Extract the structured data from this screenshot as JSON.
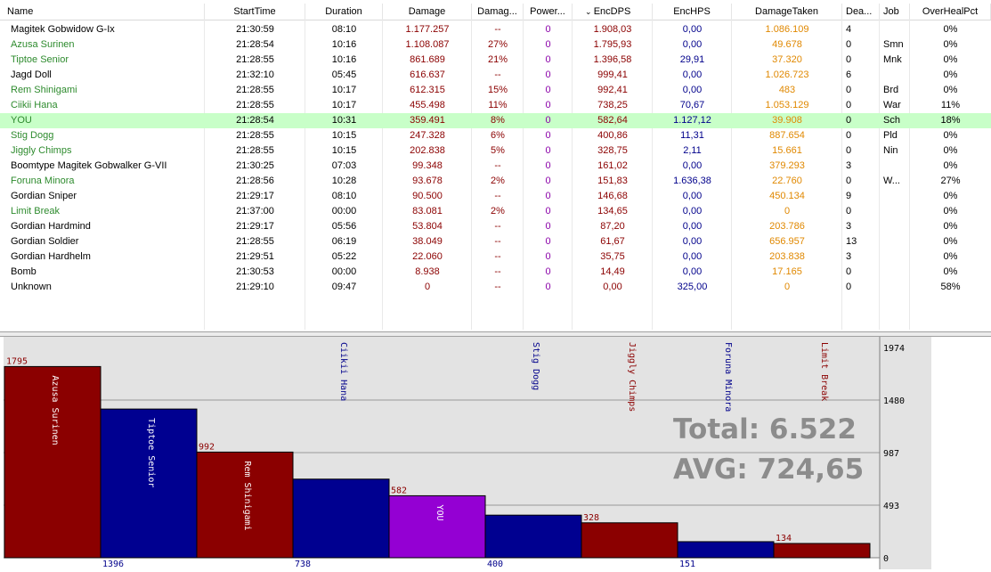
{
  "columns": [
    {
      "key": "name",
      "label": "Name",
      "align": "left"
    },
    {
      "key": "start",
      "label": "StartTime",
      "align": "center"
    },
    {
      "key": "duration",
      "label": "Duration",
      "align": "center"
    },
    {
      "key": "damage",
      "label": "Damage",
      "align": "center"
    },
    {
      "key": "damage_pct",
      "label": "Damag...",
      "align": "center"
    },
    {
      "key": "power",
      "label": "Power...",
      "align": "center"
    },
    {
      "key": "encdps",
      "label": "EncDPS",
      "align": "center"
    },
    {
      "key": "enchps",
      "label": "EncHPS",
      "align": "center"
    },
    {
      "key": "taken",
      "label": "DamageTaken",
      "align": "center"
    },
    {
      "key": "deaths",
      "label": "Dea...",
      "align": "left"
    },
    {
      "key": "job",
      "label": "Job",
      "align": "left"
    },
    {
      "key": "overheal",
      "label": "OverHealPct",
      "align": "center"
    }
  ],
  "sort_indicator": "⌄",
  "colors": {
    "ally": "#2e8b2e",
    "enemy": "#000000",
    "damage": "#8b0000",
    "power": "#8a00a8",
    "dps": "#8b0000",
    "hps": "#00008b",
    "taken": "#e08800",
    "selected": "#c8ffc8",
    "bar_red": "#8b0000",
    "bar_blue": "#000090",
    "bar_you": "#9400d3",
    "total_text": "#8c8c8c"
  },
  "rows": [
    {
      "name": "Magitek Gobwidow G-Ix",
      "start": "21:30:59",
      "duration": "08:10",
      "damage": "1.177.257",
      "damage_pct": "--",
      "power": "0",
      "encdps": "1.908,03",
      "enchps": "0,00",
      "taken": "1.086.109",
      "deaths": "4",
      "job": "",
      "overheal": "0%",
      "kind": "enemy",
      "selected": false
    },
    {
      "name": "Azusa Surinen",
      "start": "21:28:54",
      "duration": "10:16",
      "damage": "1.108.087",
      "damage_pct": "27%",
      "power": "0",
      "encdps": "1.795,93",
      "enchps": "0,00",
      "taken": "49.678",
      "deaths": "0",
      "job": "Smn",
      "overheal": "0%",
      "kind": "ally",
      "selected": false
    },
    {
      "name": "Tiptoe Senior",
      "start": "21:28:55",
      "duration": "10:16",
      "damage": "861.689",
      "damage_pct": "21%",
      "power": "0",
      "encdps": "1.396,58",
      "enchps": "29,91",
      "taken": "37.320",
      "deaths": "0",
      "job": "Mnk",
      "overheal": "0%",
      "kind": "ally",
      "selected": false
    },
    {
      "name": "Jagd Doll",
      "start": "21:32:10",
      "duration": "05:45",
      "damage": "616.637",
      "damage_pct": "--",
      "power": "0",
      "encdps": "999,41",
      "enchps": "0,00",
      "taken": "1.026.723",
      "deaths": "6",
      "job": "",
      "overheal": "0%",
      "kind": "enemy",
      "selected": false
    },
    {
      "name": "Rem Shinigami",
      "start": "21:28:55",
      "duration": "10:17",
      "damage": "612.315",
      "damage_pct": "15%",
      "power": "0",
      "encdps": "992,41",
      "enchps": "0,00",
      "taken": "483",
      "deaths": "0",
      "job": "Brd",
      "overheal": "0%",
      "kind": "ally",
      "selected": false
    },
    {
      "name": "Ciikii Hana",
      "start": "21:28:55",
      "duration": "10:17",
      "damage": "455.498",
      "damage_pct": "11%",
      "power": "0",
      "encdps": "738,25",
      "enchps": "70,67",
      "taken": "1.053.129",
      "deaths": "0",
      "job": "War",
      "overheal": "11%",
      "kind": "ally",
      "selected": false
    },
    {
      "name": "YOU",
      "start": "21:28:54",
      "duration": "10:31",
      "damage": "359.491",
      "damage_pct": "8%",
      "power": "0",
      "encdps": "582,64",
      "enchps": "1.127,12",
      "taken": "39.908",
      "deaths": "0",
      "job": "Sch",
      "overheal": "18%",
      "kind": "ally",
      "selected": true
    },
    {
      "name": "Stig Dogg",
      "start": "21:28:55",
      "duration": "10:15",
      "damage": "247.328",
      "damage_pct": "6%",
      "power": "0",
      "encdps": "400,86",
      "enchps": "11,31",
      "taken": "887.654",
      "deaths": "0",
      "job": "Pld",
      "overheal": "0%",
      "kind": "ally",
      "selected": false
    },
    {
      "name": "Jiggly Chimps",
      "start": "21:28:55",
      "duration": "10:15",
      "damage": "202.838",
      "damage_pct": "5%",
      "power": "0",
      "encdps": "328,75",
      "enchps": "2,11",
      "taken": "15.661",
      "deaths": "0",
      "job": "Nin",
      "overheal": "0%",
      "kind": "ally",
      "selected": false
    },
    {
      "name": "Boomtype Magitek Gobwalker G-VII",
      "start": "21:30:25",
      "duration": "07:03",
      "damage": "99.348",
      "damage_pct": "--",
      "power": "0",
      "encdps": "161,02",
      "enchps": "0,00",
      "taken": "379.293",
      "deaths": "3",
      "job": "",
      "overheal": "0%",
      "kind": "enemy",
      "selected": false
    },
    {
      "name": "Foruna Minora",
      "start": "21:28:56",
      "duration": "10:28",
      "damage": "93.678",
      "damage_pct": "2%",
      "power": "0",
      "encdps": "151,83",
      "enchps": "1.636,38",
      "taken": "22.760",
      "deaths": "0",
      "job": "W...",
      "overheal": "27%",
      "kind": "ally",
      "selected": false
    },
    {
      "name": "Gordian Sniper",
      "start": "21:29:17",
      "duration": "08:10",
      "damage": "90.500",
      "damage_pct": "--",
      "power": "0",
      "encdps": "146,68",
      "enchps": "0,00",
      "taken": "450.134",
      "deaths": "9",
      "job": "",
      "overheal": "0%",
      "kind": "enemy",
      "selected": false
    },
    {
      "name": "Limit Break",
      "start": "21:37:00",
      "duration": "00:00",
      "damage": "83.081",
      "damage_pct": "2%",
      "power": "0",
      "encdps": "134,65",
      "enchps": "0,00",
      "taken": "0",
      "deaths": "0",
      "job": "",
      "overheal": "0%",
      "kind": "ally",
      "selected": false
    },
    {
      "name": "Gordian Hardmind",
      "start": "21:29:17",
      "duration": "05:56",
      "damage": "53.804",
      "damage_pct": "--",
      "power": "0",
      "encdps": "87,20",
      "enchps": "0,00",
      "taken": "203.786",
      "deaths": "3",
      "job": "",
      "overheal": "0%",
      "kind": "enemy",
      "selected": false
    },
    {
      "name": "Gordian Soldier",
      "start": "21:28:55",
      "duration": "06:19",
      "damage": "38.049",
      "damage_pct": "--",
      "power": "0",
      "encdps": "61,67",
      "enchps": "0,00",
      "taken": "656.957",
      "deaths": "13",
      "job": "",
      "overheal": "0%",
      "kind": "enemy",
      "selected": false
    },
    {
      "name": "Gordian Hardhelm",
      "start": "21:29:51",
      "duration": "05:22",
      "damage": "22.060",
      "damage_pct": "--",
      "power": "0",
      "encdps": "35,75",
      "enchps": "0,00",
      "taken": "203.838",
      "deaths": "3",
      "job": "",
      "overheal": "0%",
      "kind": "enemy",
      "selected": false
    },
    {
      "name": "Bomb",
      "start": "21:30:53",
      "duration": "00:00",
      "damage": "8.938",
      "damage_pct": "--",
      "power": "0",
      "encdps": "14,49",
      "enchps": "0,00",
      "taken": "17.165",
      "deaths": "0",
      "job": "",
      "overheal": "0%",
      "kind": "enemy",
      "selected": false
    },
    {
      "name": "Unknown",
      "start": "21:29:10",
      "duration": "09:47",
      "damage": "0",
      "damage_pct": "--",
      "power": "0",
      "encdps": "0,00",
      "enchps": "325,00",
      "taken": "0",
      "deaths": "0",
      "job": "",
      "overheal": "58%",
      "kind": "enemy",
      "selected": false
    }
  ],
  "chart_data": {
    "type": "bar",
    "title": "",
    "total_label": "Total: 6.522",
    "avg_label": "AVG: 724,65",
    "ylim": [
      0,
      1974
    ],
    "yticks": [
      "1974",
      "1480",
      "987",
      "493",
      "0"
    ],
    "ytick_values": [
      1974,
      1480,
      987,
      493,
      0
    ],
    "grid": true,
    "bars": [
      {
        "name": "Azusa Surinen",
        "value": 1795,
        "label": "1795",
        "label_pos": "top",
        "color": "red",
        "name_pos": "inside"
      },
      {
        "name": "Tiptoe Senior",
        "value": 1396,
        "label": "1396",
        "label_pos": "bottom",
        "color": "blue",
        "name_pos": "inside"
      },
      {
        "name": "Rem Shinigami",
        "value": 992,
        "label": "992",
        "label_pos": "top",
        "color": "red",
        "name_pos": "inside"
      },
      {
        "name": "Ciikii Hana",
        "value": 738,
        "label": "738",
        "label_pos": "bottom",
        "color": "blue",
        "name_pos": "above"
      },
      {
        "name": "YOU",
        "value": 582,
        "label": "582",
        "label_pos": "top",
        "color": "you",
        "name_pos": "inside"
      },
      {
        "name": "Stig Dogg",
        "value": 400,
        "label": "400",
        "label_pos": "bottom",
        "color": "blue",
        "name_pos": "above"
      },
      {
        "name": "Jiggly Chimps",
        "value": 328,
        "label": "328",
        "label_pos": "top",
        "color": "red",
        "name_pos": "above"
      },
      {
        "name": "Foruna Minora",
        "value": 151,
        "label": "151",
        "label_pos": "bottom",
        "color": "blue",
        "name_pos": "above"
      },
      {
        "name": "Limit Break",
        "value": 134,
        "label": "134",
        "label_pos": "top",
        "color": "red",
        "name_pos": "above"
      }
    ]
  }
}
